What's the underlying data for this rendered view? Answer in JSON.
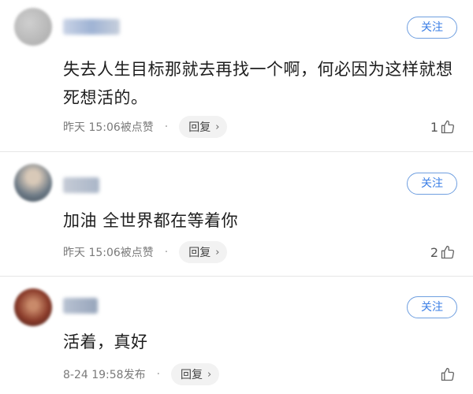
{
  "comments": [
    {
      "username": "user",
      "follow_label": "关注",
      "text": "失去人生目标那就去再找一个啊，何必因为这样就想死想活的。",
      "time": "昨天 15:06被点赞",
      "dot": "·",
      "reply_label": "回复",
      "chevron": "›",
      "like_count": "1",
      "avatar_color": "#b9b9b9"
    },
    {
      "username": "user",
      "follow_label": "关注",
      "text": "加油 全世界都在等着你",
      "time": "昨天 15:06被点赞",
      "dot": "·",
      "reply_label": "回复",
      "chevron": "›",
      "like_count": "2",
      "avatar_color": "#7d8a95"
    },
    {
      "username": "user",
      "follow_label": "关注",
      "text": "活着，真好",
      "time": "8-24 19:58发布",
      "dot": "·",
      "reply_label": "回复",
      "chevron": "›",
      "like_count": "",
      "avatar_color": "#8a3b2a"
    }
  ]
}
